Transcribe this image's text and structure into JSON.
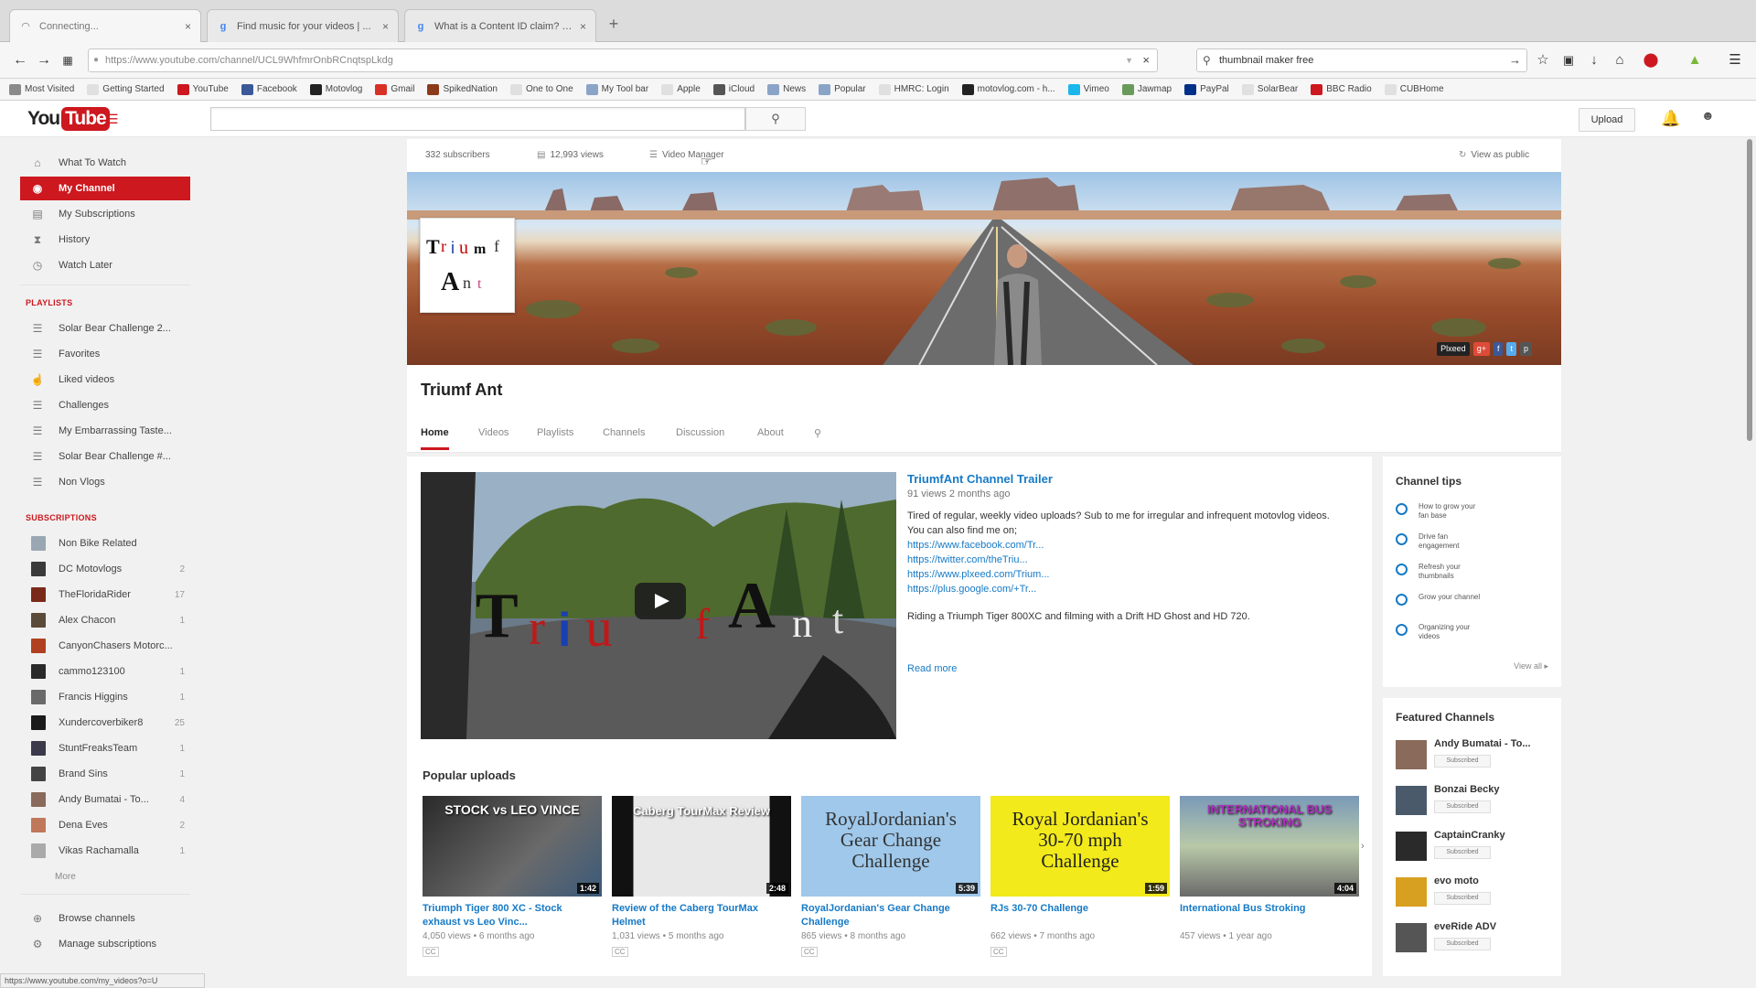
{
  "browser": {
    "tabs": [
      {
        "title": "Connecting...",
        "icon": "loading-icon"
      },
      {
        "title": "Find music for your videos | ...",
        "icon": "google-icon"
      },
      {
        "title": "What is a Content ID claim? - ...",
        "icon": "google-icon"
      }
    ],
    "url": "https://www.youtube.com/channel/UCL9WhfmrOnbRCnqtspLkdg",
    "search_value": "thumbnail maker free",
    "bookmarks": [
      {
        "label": "Most Visited",
        "color": "#8a8a8a"
      },
      {
        "label": "Getting Started",
        "color": "#e0e0e0"
      },
      {
        "label": "YouTube",
        "color": "#cc181e"
      },
      {
        "label": "Facebook",
        "color": "#3b5998"
      },
      {
        "label": "Motovlog",
        "color": "#222222"
      },
      {
        "label": "Gmail",
        "color": "#d93025"
      },
      {
        "label": "SpikedNation",
        "color": "#8b3a1a"
      },
      {
        "label": "One to One",
        "color": "#e0e0e0"
      },
      {
        "label": "My Tool bar",
        "color": "#8aa4c8"
      },
      {
        "label": "Apple",
        "color": "#e0e0e0"
      },
      {
        "label": "iCloud",
        "color": "#555555"
      },
      {
        "label": "News",
        "color": "#8aa4c8"
      },
      {
        "label": "Popular",
        "color": "#8aa4c8"
      },
      {
        "label": "HMRC: Login",
        "color": "#e0e0e0"
      },
      {
        "label": "motovlog.com - h...",
        "color": "#222222"
      },
      {
        "label": "Vimeo",
        "color": "#1ab7ea"
      },
      {
        "label": "Jawmap",
        "color": "#6a9a5a"
      },
      {
        "label": "PayPal",
        "color": "#003087"
      },
      {
        "label": "SolarBear",
        "color": "#e0e0e0"
      },
      {
        "label": "BBC Radio",
        "color": "#cc181e"
      },
      {
        "label": "CUBHome",
        "color": "#e0e0e0"
      }
    ],
    "status_url": "https://www.youtube.com/my_videos?o=U"
  },
  "youtube": {
    "logo_you": "You",
    "logo_tube": "Tube",
    "upload_label": "Upload"
  },
  "guide": {
    "main": [
      {
        "label": "What To Watch",
        "icon": "home-icon"
      },
      {
        "label": "My Channel",
        "icon": "my-channel-icon"
      },
      {
        "label": "My Subscriptions",
        "icon": "subscriptions-icon"
      },
      {
        "label": "History",
        "icon": "history-icon"
      },
      {
        "label": "Watch Later",
        "icon": "watch-later-icon"
      }
    ],
    "playlists_heading": "PLAYLISTS",
    "playlists": [
      {
        "label": "Solar Bear Challenge 2...",
        "icon": "playlist-icon"
      },
      {
        "label": "Favorites",
        "icon": "playlist-icon"
      },
      {
        "label": "Liked videos",
        "icon": "thumbs-up-icon"
      },
      {
        "label": "Challenges",
        "icon": "playlist-icon"
      },
      {
        "label": "My Embarrassing Taste...",
        "icon": "playlist-icon"
      },
      {
        "label": "Solar Bear Challenge #...",
        "icon": "playlist-icon"
      },
      {
        "label": "Non Vlogs",
        "icon": "playlist-icon"
      }
    ],
    "subscriptions_heading": "SUBSCRIPTIONS",
    "subscriptions": [
      {
        "label": "Non Bike Related",
        "count": "",
        "color": "#9aa7b3"
      },
      {
        "label": "DC Motovlogs",
        "count": "2",
        "color": "#3a3a3a"
      },
      {
        "label": "TheFloridaRider",
        "count": "17",
        "color": "#7a2a1a"
      },
      {
        "label": "Alex Chacon",
        "count": "1",
        "color": "#5a4a3a"
      },
      {
        "label": "CanyonChasers Motorc...",
        "count": "",
        "color": "#b04020"
      },
      {
        "label": "cammo123100",
        "count": "1",
        "color": "#2a2a2a"
      },
      {
        "label": "Francis Higgins",
        "count": "1",
        "color": "#6a6a6a"
      },
      {
        "label": "Xundercoverbiker8",
        "count": "25",
        "color": "#1a1a1a"
      },
      {
        "label": "StuntFreaksTeam",
        "count": "1",
        "color": "#3a3a4a"
      },
      {
        "label": "Brand Sins",
        "count": "1",
        "color": "#444444"
      },
      {
        "label": "Andy Bumatai - To...",
        "count": "4",
        "color": "#8a6a5a"
      },
      {
        "label": "Dena Eves",
        "count": "2",
        "color": "#c0785a"
      },
      {
        "label": "Vikas Rachamalla",
        "count": "1",
        "color": "#aaaaaa"
      }
    ],
    "more_label": "More",
    "footer": [
      {
        "label": "Browse channels",
        "icon": "browse-icon"
      },
      {
        "label": "Manage subscriptions",
        "icon": "manage-icon"
      }
    ]
  },
  "channel": {
    "subscribers": "332 subscribers",
    "views": "12,993 views",
    "video_manager": "Video Manager",
    "view_as_public": "View as public",
    "name": "Triumf Ant",
    "avatar_text_line1": "Triumf",
    "avatar_text_line2": "Ant",
    "tabs": [
      "Home",
      "Videos",
      "Playlists",
      "Channels",
      "Discussion",
      "About"
    ],
    "banner_links": [
      {
        "label": "Plxeed",
        "color": "#222222"
      },
      {
        "label": "g+",
        "color": "#dd4b39"
      },
      {
        "label": "f",
        "color": "#3b5998"
      },
      {
        "label": "t",
        "color": "#55acee"
      },
      {
        "label": "p",
        "color": "#555555"
      }
    ]
  },
  "trailer": {
    "title": "TriumfAnt Channel Trailer",
    "meta": "91 views  2 months ago",
    "desc_line1": "Tired of regular, weekly video uploads? Sub to me for irregular and infrequent motovlog videos.",
    "desc_line2": "You can also find me on;",
    "links": [
      "https://www.facebook.com/Tr...",
      "https://twitter.com/theTriu...",
      "https://www.plxeed.com/Trium...",
      "https://plus.google.com/+Tr..."
    ],
    "desc_line3": "Riding a Triumph Tiger 800XC and filming with a Drift HD Ghost and HD 720.",
    "read_more": "Read more",
    "overlay_text": "TriumfAnt"
  },
  "popular": {
    "heading": "Popular uploads",
    "videos": [
      {
        "title": "Triumph Tiger 800 XC - Stock exhaust vs Leo Vinc...",
        "meta": "4,050 views  •  6 months ago",
        "duration": "1:42",
        "thumb_text": "STOCK vs LEO VINCE",
        "cc": "CC"
      },
      {
        "title": "Review of the Caberg TourMax Helmet",
        "meta": "1,031 views  •  5 months ago",
        "duration": "2:48",
        "thumb_text": "Caberg TourMax Review",
        "cc": "CC"
      },
      {
        "title": "RoyalJordanian's Gear Change Challenge",
        "meta": "865 views  •  8 months ago",
        "duration": "5:39",
        "thumb_text": "RoyalJordanian's Gear Change Challenge",
        "cc": "CC"
      },
      {
        "title": "RJs 30-70 Challenge",
        "meta": "662 views  •  7 months ago",
        "duration": "1:59",
        "thumb_text": "Royal Jordanian's 30-70 mph Challenge",
        "cc": "CC"
      },
      {
        "title": "International Bus Stroking",
        "meta": "457 views  •  1 year ago",
        "duration": "4:04",
        "thumb_text": "INTERNATIONAL BUS STROKING",
        "cc": ""
      }
    ]
  },
  "tips": {
    "title": "Channel tips",
    "items": [
      "How to grow your fan base",
      "Drive fan engagement",
      "Refresh your thumbnails",
      "Grow your channel",
      "Organizing your videos"
    ],
    "view_all": "View all"
  },
  "featured": {
    "title": "Featured Channels",
    "channels": [
      {
        "name": "Andy Bumatai - To...",
        "color": "#8a6a5a"
      },
      {
        "name": "Bonzai Becky",
        "color": "#4a5a6a"
      },
      {
        "name": "CaptainCranky",
        "color": "#2a2a2a"
      },
      {
        "name": "evo moto",
        "color": "#d8a020"
      },
      {
        "name": "eveRide ADV",
        "color": "#555555"
      }
    ],
    "subscribed_label": "Subscribed"
  }
}
